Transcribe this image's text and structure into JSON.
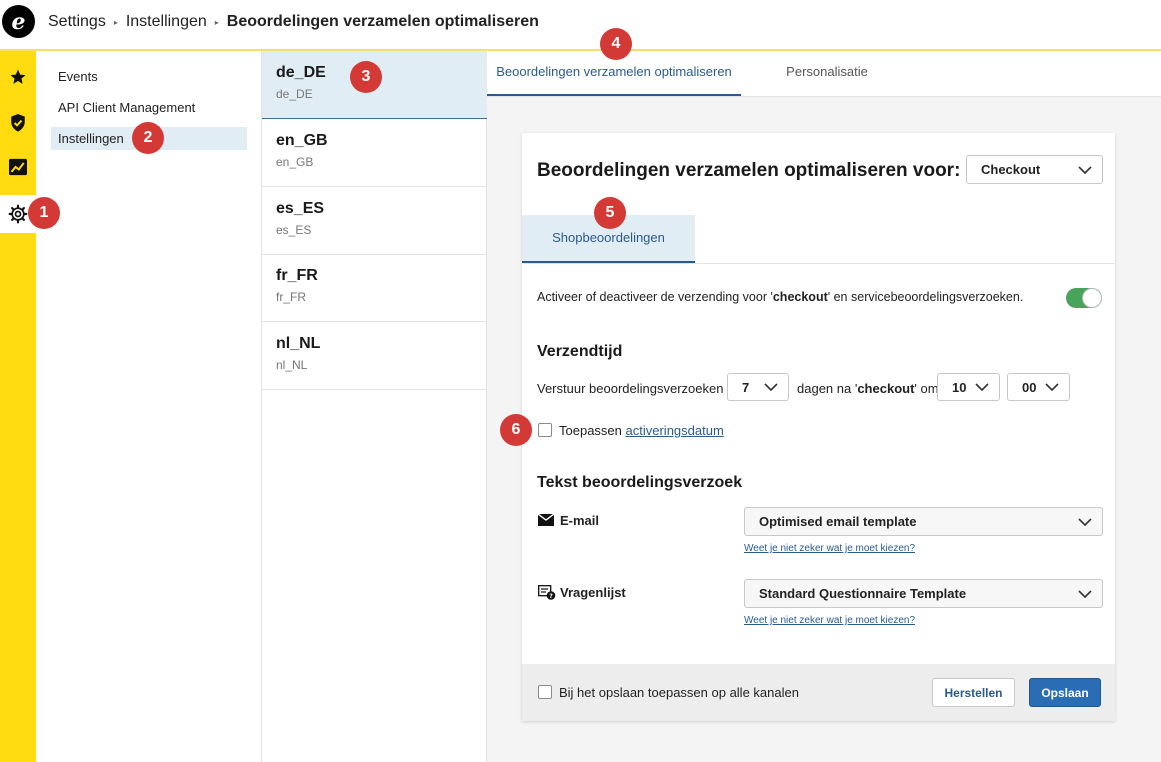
{
  "header": {
    "logo_letter": "e",
    "breadcrumbs": [
      "Settings",
      "Instellingen",
      "Beoordelingen verzamelen optimaliseren"
    ]
  },
  "rail": {
    "icons": [
      "star-icon",
      "shield-check-icon",
      "chart-trend-icon",
      "gear-icon"
    ],
    "active": "gear-icon"
  },
  "sidebar": {
    "items": [
      {
        "label": "Events",
        "active": false
      },
      {
        "label": "API Client Management",
        "active": false
      },
      {
        "label": "Instellingen",
        "active": true
      }
    ]
  },
  "locales": [
    {
      "code": "de_DE",
      "sub": "de_DE",
      "active": true
    },
    {
      "code": "en_GB",
      "sub": "en_GB",
      "active": false
    },
    {
      "code": "es_ES",
      "sub": "es_ES",
      "active": false
    },
    {
      "code": "fr_FR",
      "sub": "fr_FR",
      "active": false
    },
    {
      "code": "nl_NL",
      "sub": "nl_NL",
      "active": false
    }
  ],
  "main": {
    "tabs": [
      {
        "label": "Beoordelingen verzamelen optimaliseren",
        "active": true
      },
      {
        "label": "Personalisatie",
        "active": false
      }
    ],
    "card": {
      "title": "Beoordelingen verzamelen optimaliseren voor:",
      "channel_select": "Checkout",
      "sub_tab": "Shopbeoordelingen",
      "activation": {
        "pre": "Activeer of deactiveer de verzending voor '",
        "bold": "checkout",
        "post": "' en servicebeoordelingsverzoeken.",
        "enabled": true
      },
      "send_time": {
        "heading": "Verzendtijd",
        "label_pre": "Verstuur beoordelingsverzoeken",
        "days": "7",
        "label_mid_pre": "dagen na '",
        "label_mid_bold": "checkout",
        "label_mid_post": "' om",
        "hour": "10",
        "minute": "00"
      },
      "apply_activation": {
        "label": "Toepassen",
        "link": "activeringsdatum",
        "checked": false
      },
      "request_text": {
        "heading": "Tekst beoordelingsverzoek",
        "email_label": "E-mail",
        "email_template": "Optimised email template",
        "email_help": "Weet je niet zeker wat je moet kiezen?",
        "questionnaire_label": "Vragenlijst",
        "questionnaire_template": "Standard Questionnaire Template",
        "questionnaire_help": "Weet je niet zeker wat je moet kiezen?"
      },
      "footer": {
        "apply_all_label": "Bij het opslaan toepassen op alle kanalen",
        "apply_all_checked": false,
        "reset_label": "Herstellen",
        "save_label": "Opslaan"
      }
    }
  },
  "annotations": [
    "1",
    "2",
    "3",
    "4",
    "5",
    "6"
  ],
  "colors": {
    "rail": "#ffdc0f",
    "accent": "#2a5b8e",
    "primary_button": "#2a6db5",
    "toggle_on": "#4aa35a",
    "badge": "#d33a36",
    "selected_bg": "#e1edf5"
  }
}
